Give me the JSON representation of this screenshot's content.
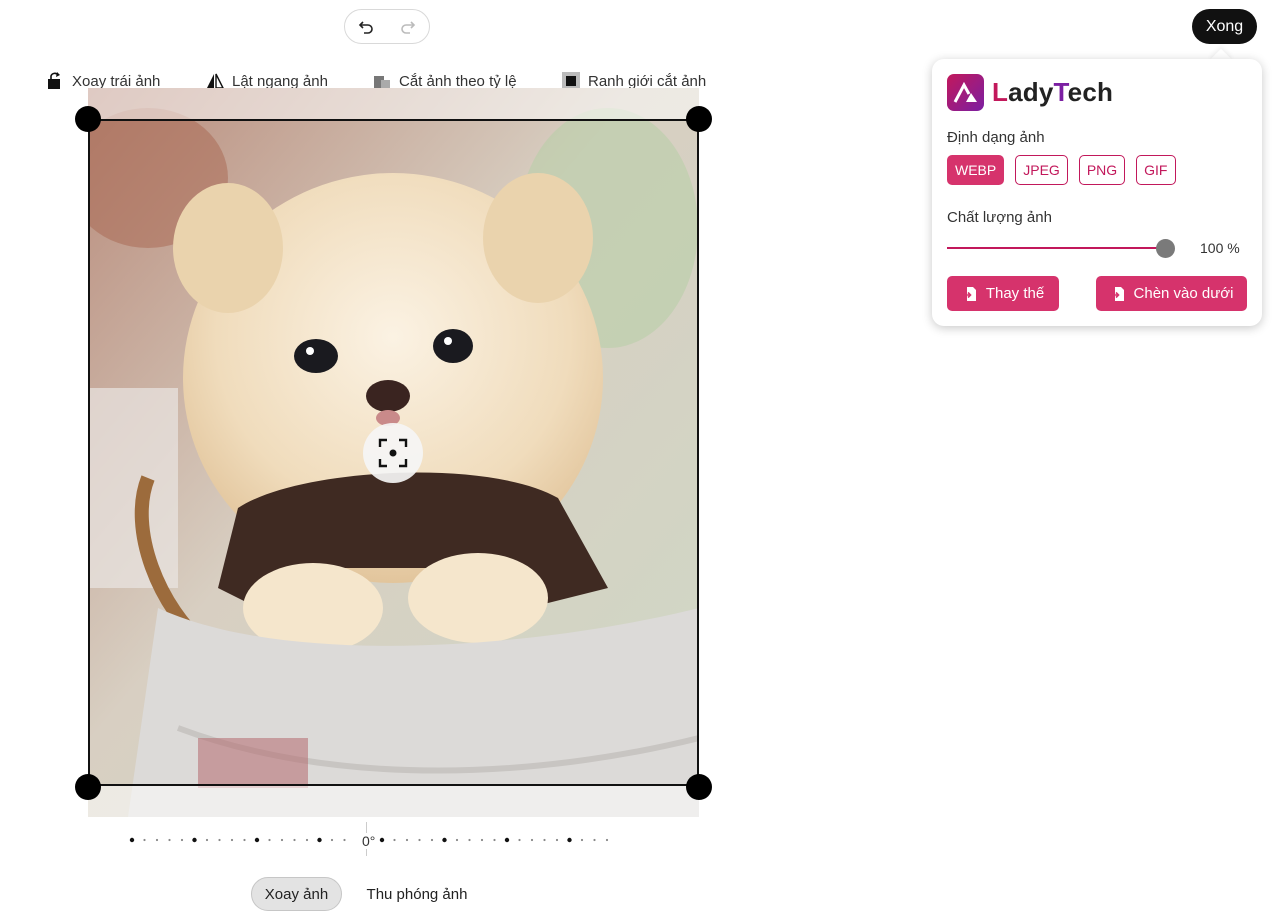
{
  "toolbar": {
    "rotate_left": "Xoay trái ảnh",
    "flip_horizontal": "Lật ngang ảnh",
    "crop_ratio": "Cắt ảnh theo tỷ lệ",
    "crop_boundary": "Ranh giới cắt ảnh",
    "done": "Xong"
  },
  "icons": {
    "undo": "undo-icon",
    "redo": "redo-icon",
    "focus": "focus-target-icon"
  },
  "editor": {
    "angle": "0°"
  },
  "tabs": {
    "rotate": "Xoay ảnh",
    "zoom": "Thu phóng ảnh"
  },
  "panel": {
    "brand_first": "L",
    "brand_mid": "ady",
    "brand_second": "T",
    "brand_rest": "ech",
    "format_label": "Định dạng ảnh",
    "formats": [
      "WEBP",
      "JPEG",
      "PNG",
      "GIF"
    ],
    "selected_format": "WEBP",
    "quality_label": "Chất lượng ảnh",
    "quality_value": "100 %",
    "quality_fraction": 1.0,
    "replace_label": "Thay thế",
    "insert_label": "Chèn vào dưới"
  },
  "colors": {
    "accent": "#d6336c",
    "accent_border": "#c2185b",
    "dark": "#111111"
  }
}
